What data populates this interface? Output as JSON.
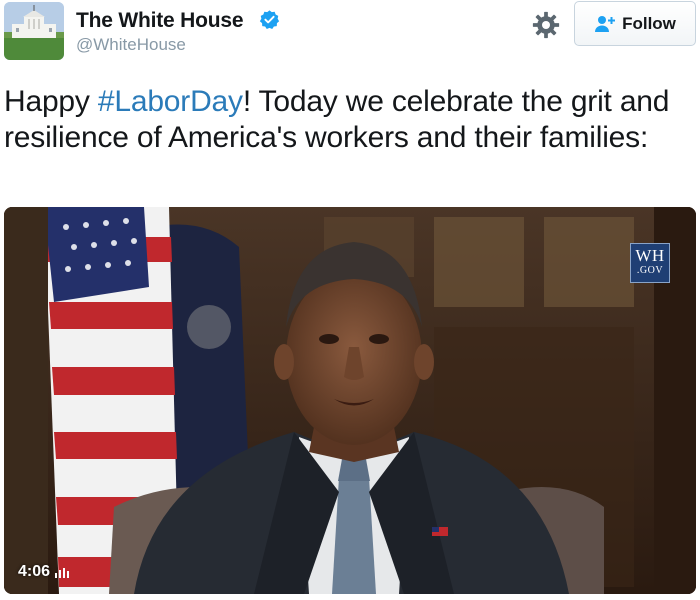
{
  "account": {
    "name": "The White House",
    "handle": "@WhiteHouse"
  },
  "actions": {
    "follow_label": "Follow"
  },
  "tweet": {
    "text_before": "Happy ",
    "hashtag": "#LaborDay",
    "text_after": "! Today we celebrate the grit and resilience of America's workers and their families:"
  },
  "video": {
    "logo_top": "WH",
    "logo_bottom": ".GOV",
    "duration": "4:06"
  },
  "icons": {
    "verified": "verified-badge-icon",
    "settings": "gear-icon",
    "follow": "add-user-icon",
    "volume": "volume-bars-icon"
  },
  "colors": {
    "accent": "#2b7bb9",
    "text": "#14171a",
    "muted": "#8899a6",
    "verified": "#1da1f2"
  }
}
